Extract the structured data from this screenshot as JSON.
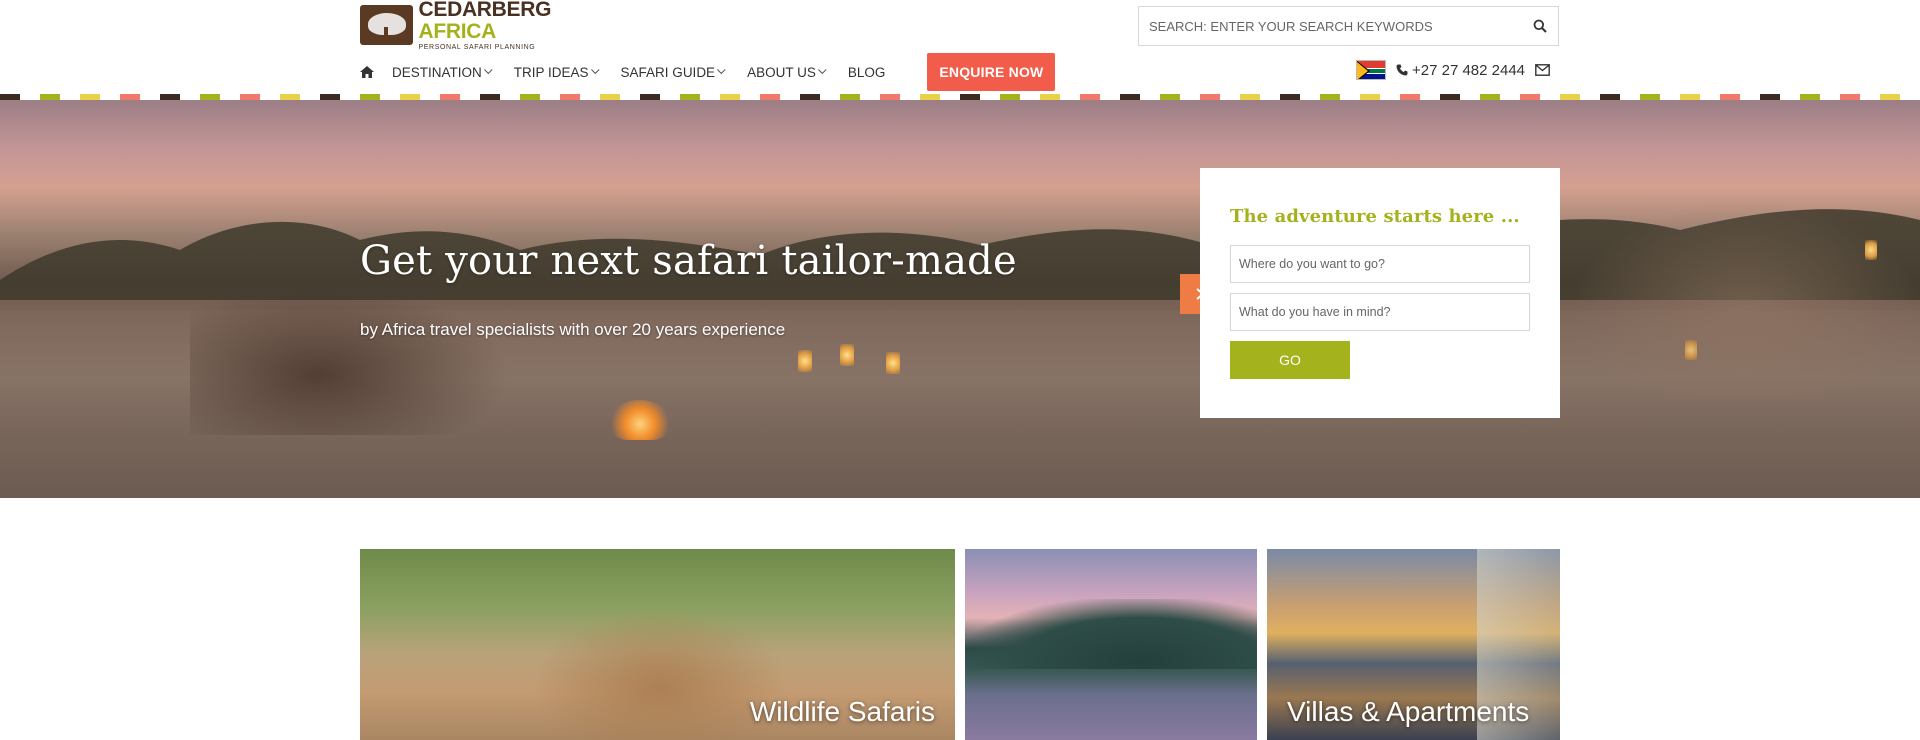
{
  "header": {
    "logo": {
      "name_main": "CEDARBERG",
      "name_accent": "AFRICA",
      "tagline": "PERSONAL SAFARI PLANNING"
    },
    "search": {
      "placeholder": "SEARCH: ENTER YOUR SEARCH KEYWORDS",
      "icon": "search-icon"
    },
    "nav": {
      "home_icon": "home-icon",
      "items": [
        {
          "label": "DESTINATION",
          "has_dropdown": true
        },
        {
          "label": "TRIP IDEAS",
          "has_dropdown": true
        },
        {
          "label": "SAFARI GUIDE",
          "has_dropdown": true
        },
        {
          "label": "ABOUT US",
          "has_dropdown": true
        },
        {
          "label": "BLOG",
          "has_dropdown": false
        }
      ],
      "cta": "ENQUIRE NOW"
    },
    "contact": {
      "flag": "south-africa-flag-icon",
      "phone": "+27 27 482 2444",
      "mail_icon": "envelope-icon"
    }
  },
  "stripe_colors": [
    "#3d2b22",
    "#a4b21e",
    "#e8d24a",
    "#f07a6a",
    "#ffffff"
  ],
  "hero": {
    "title": "Get your next safari tailor-made",
    "subtitle": "by Africa travel specialists with over 20 years experience",
    "panel": {
      "heading": "The adventure starts here ...",
      "field1_placeholder": "Where do you want to go?",
      "field2_placeholder": "What do you have in mind?",
      "go_label": "GO"
    }
  },
  "cards": [
    {
      "label": "Wildlife Safaris"
    },
    {
      "label": ""
    },
    {
      "label": "Villas & Apartments"
    }
  ],
  "colors": {
    "brand_green": "#a4b21e",
    "brand_brown": "#4a3020",
    "cta_red": "#f25c4a",
    "arrow_orange": "#f07c45"
  }
}
